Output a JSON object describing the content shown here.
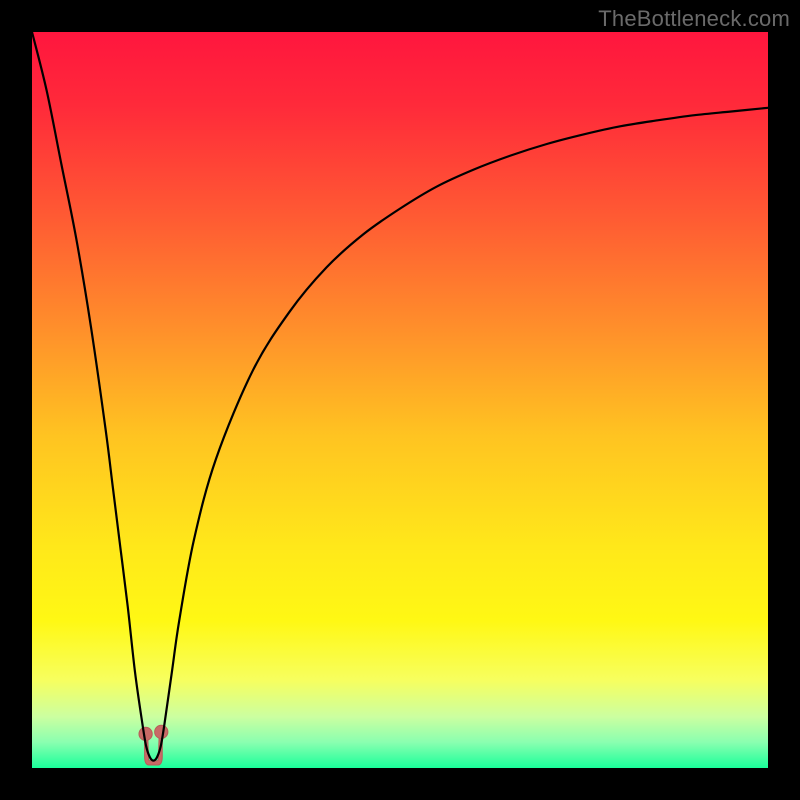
{
  "watermark": "TheBottleneck.com",
  "colors": {
    "frame": "#000000",
    "gradient_stops": [
      {
        "offset": 0.0,
        "color": "#ff163e"
      },
      {
        "offset": 0.1,
        "color": "#ff2a3a"
      },
      {
        "offset": 0.25,
        "color": "#ff5a33"
      },
      {
        "offset": 0.4,
        "color": "#ff8e2b"
      },
      {
        "offset": 0.55,
        "color": "#ffc421"
      },
      {
        "offset": 0.7,
        "color": "#ffe81a"
      },
      {
        "offset": 0.8,
        "color": "#fff814"
      },
      {
        "offset": 0.88,
        "color": "#f7ff5e"
      },
      {
        "offset": 0.93,
        "color": "#ccffa0"
      },
      {
        "offset": 0.965,
        "color": "#8affb0"
      },
      {
        "offset": 1.0,
        "color": "#1aff9a"
      }
    ],
    "curve": "#000000",
    "notch_fill": "#c86a66",
    "notch_stroke": "#b85c58"
  },
  "chart_data": {
    "type": "line",
    "title": "",
    "xlabel": "",
    "ylabel": "",
    "xlim": [
      0,
      100
    ],
    "ylim": [
      0,
      100
    ],
    "series": [
      {
        "name": "bottleneck-curve",
        "x": [
          0,
          2,
          4,
          6,
          8,
          10,
          11,
          12,
          13,
          14,
          15,
          15.5,
          16,
          16.5,
          17,
          17.5,
          18,
          19,
          20,
          22,
          25,
          30,
          35,
          40,
          45,
          50,
          55,
          60,
          65,
          70,
          75,
          80,
          85,
          90,
          95,
          100
        ],
        "y": [
          100,
          92,
          82,
          72,
          60,
          46,
          38,
          30,
          22,
          13,
          6,
          3,
          1.5,
          1,
          1.5,
          3,
          6,
          13,
          20,
          31,
          42,
          54,
          62,
          68,
          72.5,
          76,
          79,
          81.3,
          83.2,
          84.8,
          86.1,
          87.2,
          88,
          88.7,
          89.2,
          89.7
        ]
      }
    ],
    "annotations": {
      "notch_marker": {
        "x_center": 16.5,
        "width": 2.4,
        "dot_radius": 0.9
      }
    }
  }
}
